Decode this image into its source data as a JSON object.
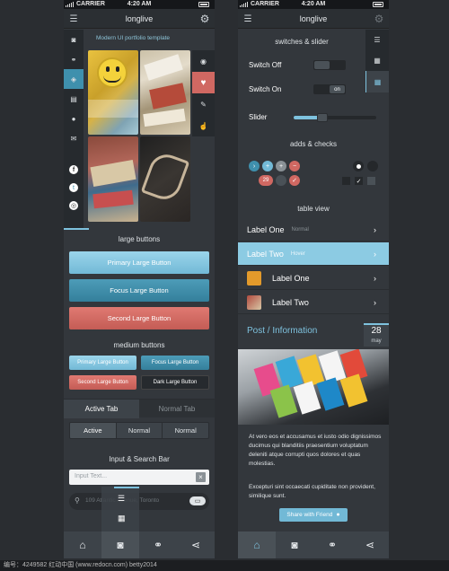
{
  "left_phone": {
    "status": {
      "carrier": "CARRIER",
      "time": "4:20 AM"
    },
    "nav": {
      "title": "longlive"
    },
    "subtitle": "Modern UI portfolio template",
    "large_buttons": {
      "heading": "large buttons",
      "primary": "Primary Large Button",
      "focus": "Focus Large Button",
      "second": "Second Large Button"
    },
    "medium_buttons": {
      "heading": "medium buttons",
      "primary": "Primary Large Button",
      "focus": "Focus Large Button",
      "second": "Second Large Button",
      "dark": "Dark Large Button"
    },
    "tabs": {
      "active": "Active Tab",
      "normal": "Normal Tab"
    },
    "segmented": [
      "Active",
      "Normal",
      "Normal"
    ],
    "search_section": {
      "heading": "Input & Search Bar",
      "input_placeholder": "Input Text...",
      "search_placeholder": "109 Atlantic Avenue, Toronto"
    }
  },
  "right_phone": {
    "status": {
      "carrier": "CARRIER",
      "time": "4:20 AM"
    },
    "nav": {
      "title": "longlive"
    },
    "switches_heading": "switches & slider",
    "switch_off_label": "Switch Off",
    "switch_on_label": "Switch On",
    "switch_on_text": "on",
    "slider_label": "Slider",
    "slider_value": 0.35,
    "adds_heading": "adds & checks",
    "badge_number": "29",
    "table_heading": "table view",
    "rows": [
      {
        "label": "Label One",
        "state": "Normal"
      },
      {
        "label": "Label Two",
        "state": "Hover"
      },
      {
        "label": "Label One",
        "state": ""
      },
      {
        "label": "Label Two",
        "state": ""
      }
    ],
    "post": {
      "title": "Post / Information",
      "day": "28",
      "month": "may",
      "body1": "At vero eos et accusamus et iusto odio dignissimos ducimus qui blanditiis praesentium voluptatum deleniti atque corrupti quos dolores et quas molestias.",
      "body2": "Excepturi sint occaecati cupiditate non provident, similique sunt.",
      "share": "Share with Friend"
    }
  },
  "footer": "编号：4249582   红动中国 (www.redocn.com)   betty2014",
  "colors": {
    "accent": "#7ec2de",
    "primary_btn": "#80c5e1",
    "focus_btn": "#3f90ad",
    "second_btn": "#d06862",
    "hover_row": "#8ccbe3",
    "dark_bg": "#33373c"
  },
  "icons": [
    "menu-icon",
    "gear-icon",
    "camera-icon",
    "binoculars-icon",
    "tag-icon",
    "id-card-icon",
    "user-icon",
    "mail-icon",
    "facebook-icon",
    "twitter-icon",
    "dribbble-icon",
    "eye-icon",
    "heart-icon",
    "chat-icon",
    "thumbs-up-icon",
    "home-icon",
    "share-icon",
    "list-icon",
    "grid-icon",
    "info-icon"
  ]
}
